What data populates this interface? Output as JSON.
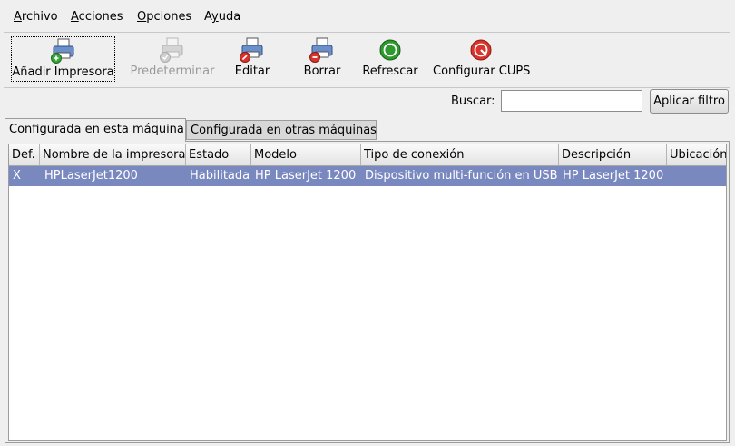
{
  "menu": [
    {
      "mnemonic": "A",
      "rest": "rchivo"
    },
    {
      "mnemonic": "A",
      "rest": "cciones"
    },
    {
      "mnemonic": "O",
      "rest": "pciones"
    },
    {
      "pre": "A",
      "mnemonic": "y",
      "rest": "uda"
    }
  ],
  "toolbar": {
    "add": "Añadir Impresora",
    "default": "Predeterminar",
    "edit": "Editar",
    "delete": "Borrar",
    "refresh": "Refrescar",
    "cups": "Configurar CUPS"
  },
  "search": {
    "label": "Buscar:",
    "value": "",
    "filter_button": "Aplicar filtro"
  },
  "tabs": [
    "Configurada en esta máquina",
    "Configurada en otras máquinas"
  ],
  "table": {
    "columns": [
      "Def.",
      "Nombre de la impresora",
      "Estado",
      "Modelo",
      "Tipo de conexión",
      "Descripción",
      "Ubicación"
    ],
    "rows": [
      [
        "X",
        "HPLaserJet1200",
        "Habilitada",
        "HP LaserJet 1200",
        "Dispositivo multi-función en USB",
        "HP LaserJet 1200",
        ""
      ]
    ],
    "selected_row_color": "#7a88c0"
  }
}
